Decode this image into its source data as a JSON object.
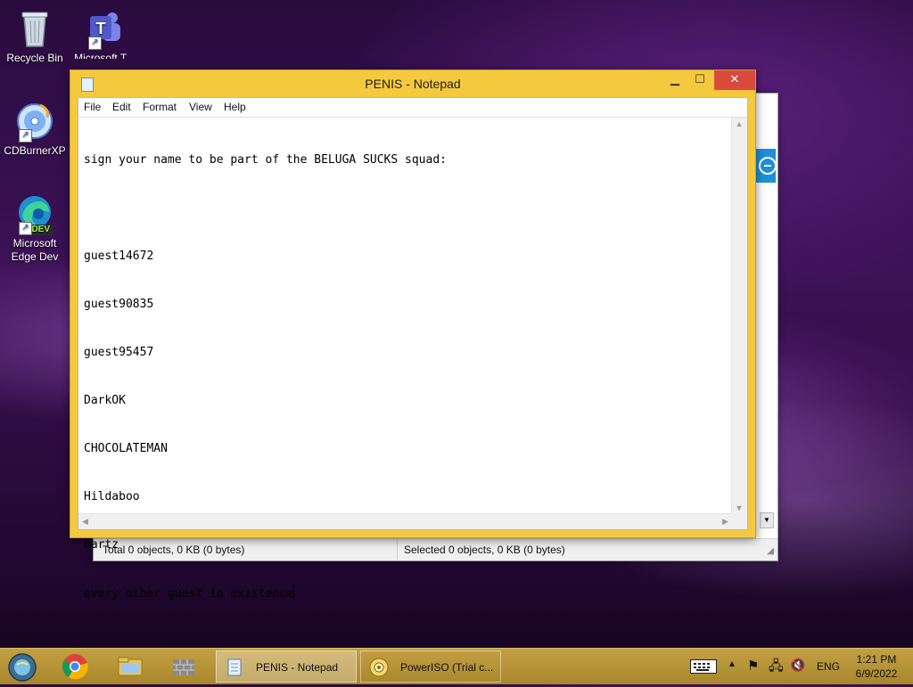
{
  "desktop": {
    "icons": [
      {
        "label": "Recycle Bin"
      },
      {
        "label": "Microsoft T..."
      },
      {
        "label": "CDBurnerXP"
      },
      {
        "label": "Microsoft Edge Dev",
        "badge": "DEV"
      }
    ]
  },
  "explorer": {
    "status_total": "Total 0 objects, 0 KB (0 bytes)",
    "status_selected": "Selected 0 objects, 0 KB (0 bytes)"
  },
  "notepad": {
    "title": "PENIS - Notepad",
    "menu": [
      "File",
      "Edit",
      "Format",
      "View",
      "Help"
    ],
    "lines": [
      "sign your name to be part of the BELUGA SUCKS squad:",
      "",
      "guest14672",
      "guest90835",
      "guest95457",
      "DarkOK",
      "CHOCOLATEMAN",
      "Hildaboo",
      "dartz",
      "every other guest in existence"
    ]
  },
  "taskbar": {
    "tasks": [
      {
        "label": "PENIS - Notepad",
        "active": true
      },
      {
        "label": "PowerISO (Trial c...",
        "active": false
      }
    ],
    "tray": {
      "language": "ENG",
      "time": "1:21 PM",
      "date": "6/9/2022"
    }
  },
  "colors": {
    "window_frame": "#f4c93d",
    "close_button": "#d94a3c",
    "taskbar": "#b89534"
  }
}
